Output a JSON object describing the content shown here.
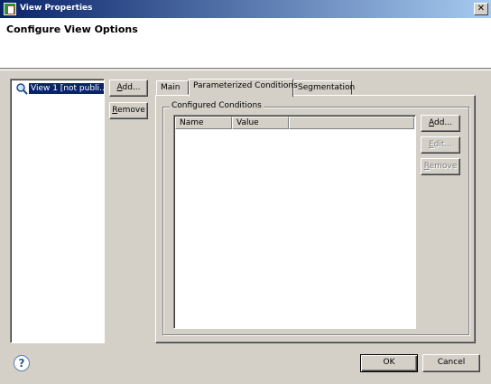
{
  "window": {
    "title": "View Properties",
    "close_glyph": "✕"
  },
  "banner": {
    "heading": "Configure View Options"
  },
  "views": {
    "items": [
      {
        "label": "View 1 [not publi...",
        "icon": "view-search-icon",
        "selected": true
      }
    ],
    "add_label_u": "A",
    "add_label_rest": "dd...",
    "remove_label_u": "R",
    "remove_label_rest": "emove"
  },
  "tabs": [
    {
      "label": "Main",
      "active": false
    },
    {
      "label": "Parameterized Conditions",
      "active": true
    },
    {
      "label": "Segmentation",
      "active": false
    }
  ],
  "conditions": {
    "group_label": "Configured Conditions",
    "columns": [
      "Name",
      "Value"
    ],
    "rows": [],
    "add_label_u": "A",
    "add_label_rest": "dd...",
    "edit_label_u": "E",
    "edit_label_rest": "dit...",
    "edit_enabled": false,
    "remove_label_u": "R",
    "remove_label_rest": "emove",
    "remove_enabled": false
  },
  "footer": {
    "help_glyph": "?",
    "ok_label": "OK",
    "cancel_label": "Cancel"
  }
}
